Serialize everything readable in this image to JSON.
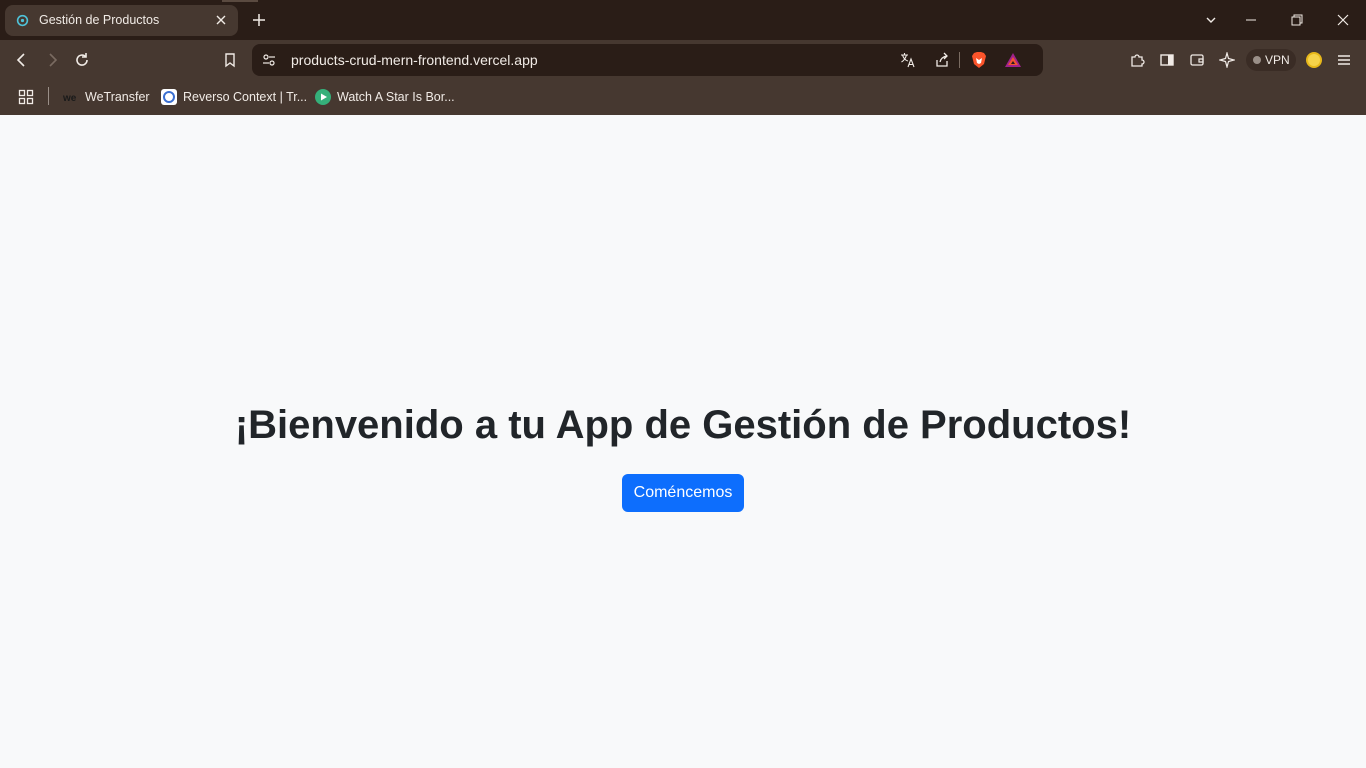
{
  "browser": {
    "tab": {
      "title": "Gestión de Productos",
      "favicon": "gear-favicon"
    },
    "address_bar": {
      "url": "products-crud-mern-frontend.vercel.app"
    },
    "vpn_label": "VPN",
    "bookmarks": [
      {
        "label": "WeTransfer",
        "icon": "wetransfer-icon"
      },
      {
        "label": "Reverso Context | Tr...",
        "icon": "reverso-icon"
      },
      {
        "label": "Watch A Star Is Bor...",
        "icon": "play-icon"
      }
    ]
  },
  "page": {
    "title": "¡Bienvenido a tu App de Gestión de Productos!",
    "cta_label": "Coméncemos"
  },
  "colors": {
    "accent": "#0d6efd",
    "page_bg": "#f8f9fa",
    "title_text": "#212529",
    "chrome_dark": "#2a1d17",
    "chrome_light": "#463830"
  }
}
